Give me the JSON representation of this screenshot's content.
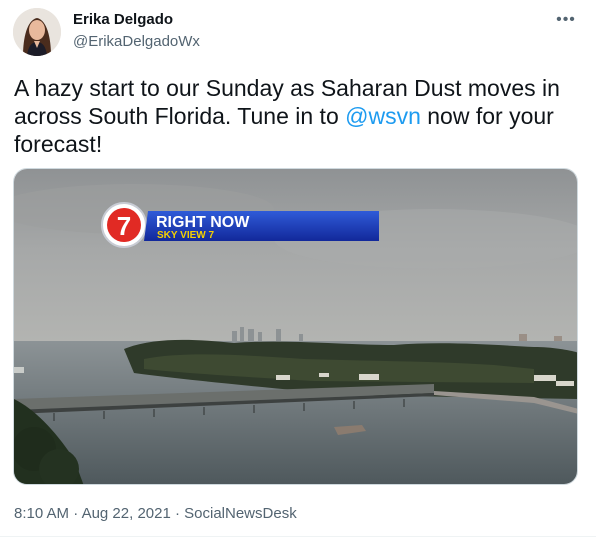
{
  "author": {
    "name": "Erika Delgado",
    "handle": "@ErikaDelgadoWx"
  },
  "tweet": {
    "text_before": "A hazy start to our Sunday as Saharan Dust moves in across South Florida. Tune in to ",
    "mention": "@wsvn",
    "text_after": " now for your forecast!"
  },
  "media": {
    "logo_number": "7",
    "banner_title": "RIGHT NOW",
    "banner_subtitle": "SKY VIEW 7"
  },
  "meta": {
    "time": "8:10 AM",
    "separator": "·",
    "date": "Aug 22, 2021",
    "source": "SocialNewsDesk"
  },
  "icons": {
    "more": "more-horizontal-icon",
    "avatar": "profile-photo"
  },
  "colors": {
    "link": "#1d9bf0",
    "secondary_text": "#536471",
    "banner_blue": "#1d3fbf",
    "banner_yellow": "#f5d000"
  }
}
